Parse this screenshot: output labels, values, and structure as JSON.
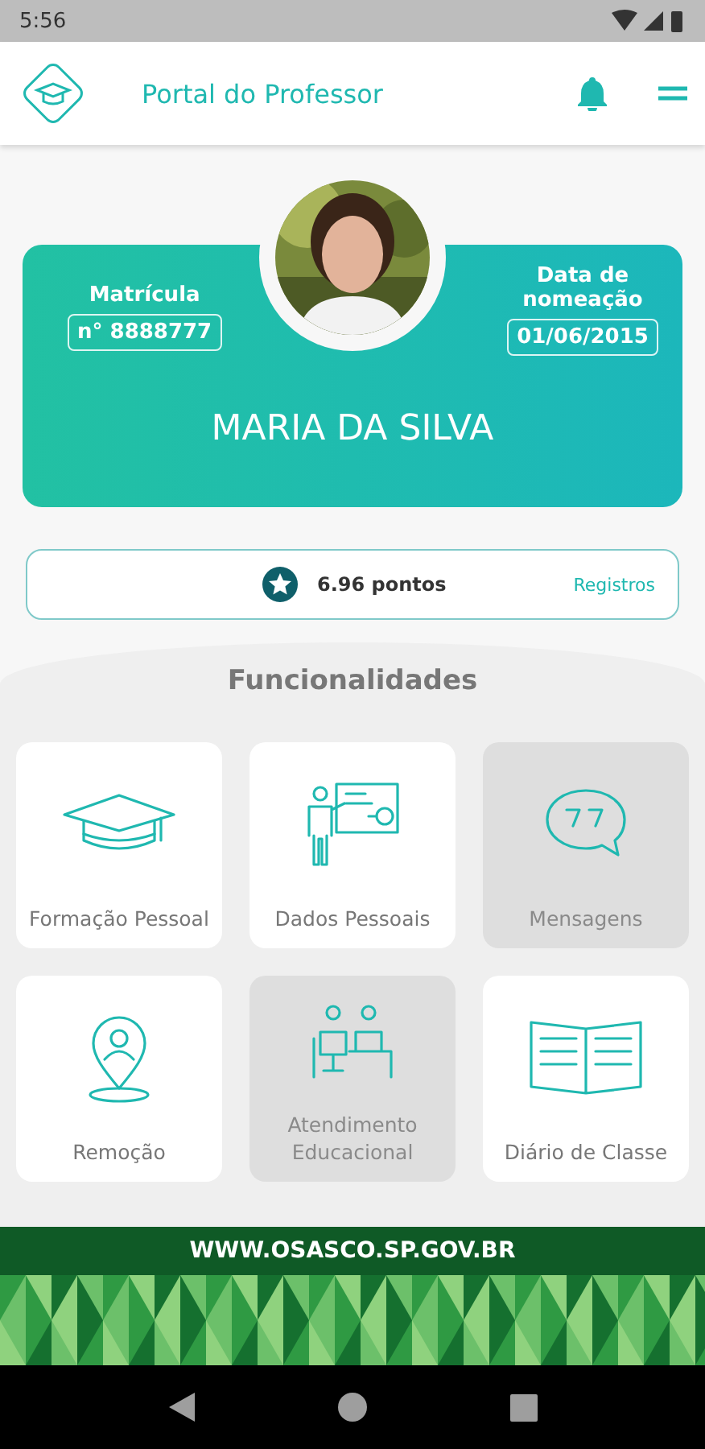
{
  "status_bar": {
    "time": "5:56"
  },
  "header": {
    "title": "Portal do Professor"
  },
  "profile": {
    "registration_label": "Matrícula",
    "registration_value": "n° 8888777",
    "date_label": "Data de nomeação",
    "date_value": "01/06/2015",
    "name": "MARIA DA SILVA"
  },
  "points": {
    "value": "6.96 pontos",
    "link": "Registros"
  },
  "section_title": "Funcionalidades",
  "tiles": [
    {
      "label": "Formação Pessoal",
      "disabled": false
    },
    {
      "label": "Dados Pessoais",
      "disabled": false
    },
    {
      "label": "Mensagens",
      "disabled": true
    },
    {
      "label": "Remoção",
      "disabled": false
    },
    {
      "label": "Atendimento Educacional",
      "disabled": true
    },
    {
      "label": "Diário de Classe",
      "disabled": false
    }
  ],
  "footer": {
    "url": "WWW.OSASCO.SP.GOV.BR"
  }
}
